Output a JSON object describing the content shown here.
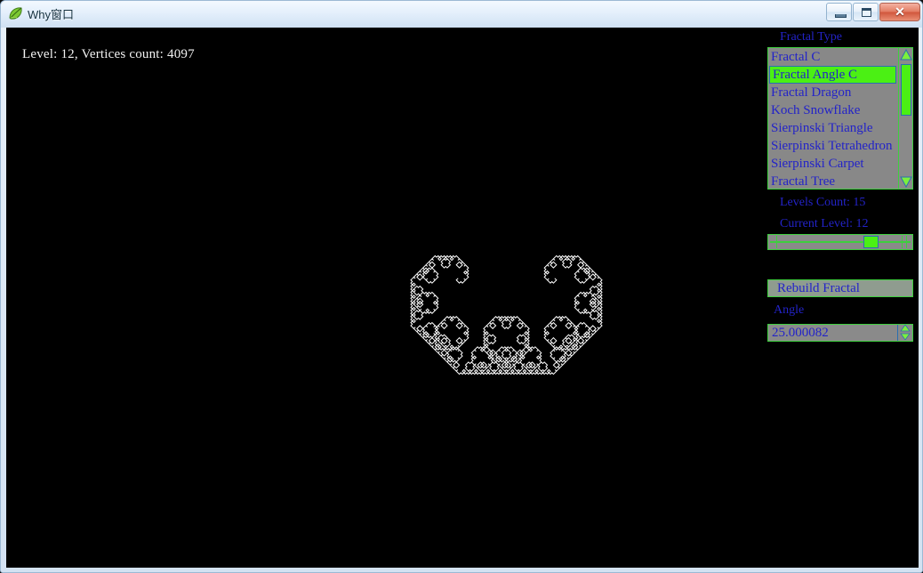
{
  "window": {
    "title": "Why窗口",
    "icon": "leaf-icon",
    "controls": {
      "minimize": "minimize-icon",
      "maximize": "maximize-icon",
      "close": "✕"
    },
    "frame_color": "#d3e2f2",
    "close_color": "#d1563c"
  },
  "canvas": {
    "status": "Level: 12, Vertices count: 4097",
    "background": "#000000",
    "curve_color": "#ffffff"
  },
  "panel": {
    "fractal_type_label": "Fractal Type",
    "fractal_types": [
      "Fractal C",
      "Fractal Angle C",
      "Fractal Dragon",
      "Koch Snowflake",
      "Sierpinski Triangle",
      "Sierpinski Tetrahedron",
      "Sierpinski Carpet",
      "Fractal Tree"
    ],
    "selected_fractal_type": "Fractal Angle C",
    "levels_count_label": "Levels Count: 15",
    "current_level_label": "Current Level: 12",
    "levels_count": 15,
    "current_level": 12,
    "rebuild_label": "Rebuild Fractal",
    "angle_label": "Angle",
    "angle_value": "25.000082",
    "accent_green": "#4bf014",
    "border_green": "#3ecf3e",
    "text_blue": "#2323c8",
    "control_gray": "#8a8a8a"
  }
}
